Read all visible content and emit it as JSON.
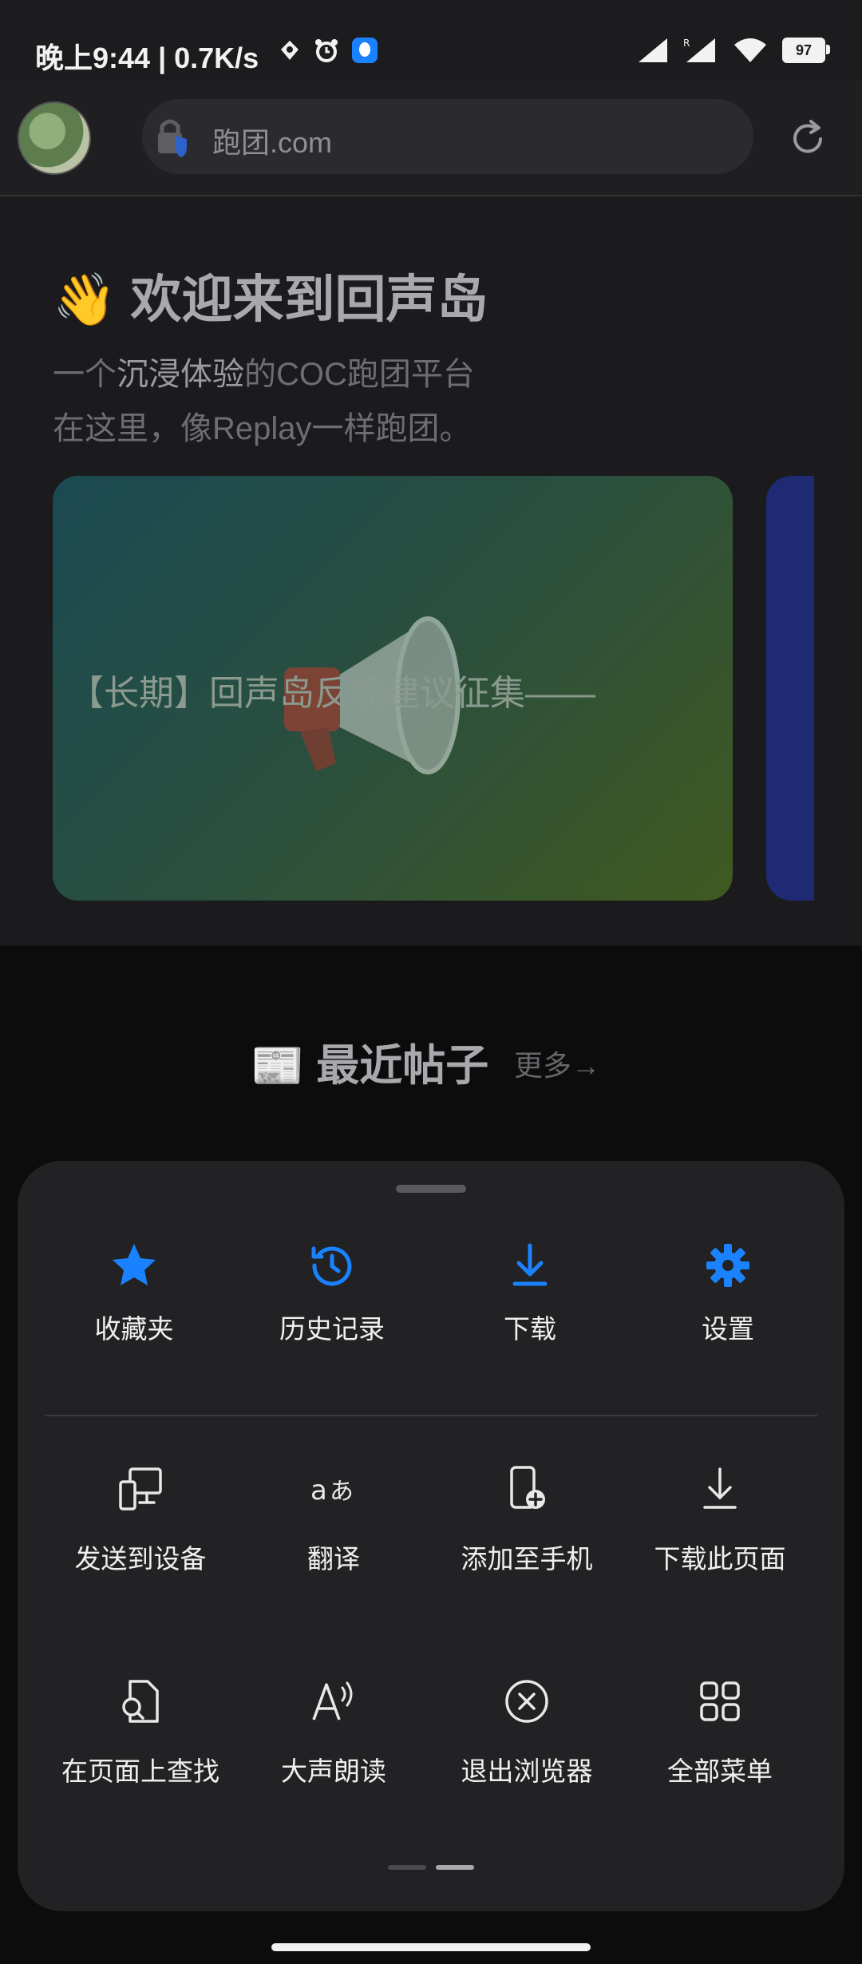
{
  "status_bar": {
    "time": "晚上9:44",
    "speed": "0.7K/s",
    "battery": "97",
    "accent": "#1a82ff"
  },
  "address_bar": {
    "url": "跑团.com"
  },
  "page": {
    "hero_emoji": "👋",
    "hero_title": "欢迎来到回声岛",
    "subtitle_prefix": "一个",
    "subtitle_highlight": "沉浸体验",
    "subtitle_suffix": "的COC跑团平台",
    "subtitle_line2": "在这里，像Replay一样跑团。",
    "banner_text": "【长期】回声岛反馈建议征集——",
    "recent_emoji": "📰",
    "recent_title": "最近帖子",
    "recent_more": "更多→"
  },
  "menu": {
    "quick_actions": [
      {
        "label": "收藏夹",
        "icon": "star-icon"
      },
      {
        "label": "历史记录",
        "icon": "history-icon"
      },
      {
        "label": "下载",
        "icon": "download-icon"
      },
      {
        "label": "设置",
        "icon": "gear-icon"
      }
    ],
    "items": [
      {
        "label": "发送到设备",
        "icon": "send-to-device-icon"
      },
      {
        "label": "翻译",
        "icon": "translate-icon"
      },
      {
        "label": "添加至手机",
        "icon": "add-to-phone-icon"
      },
      {
        "label": "下载此页面",
        "icon": "download-page-icon"
      },
      {
        "label": "在页面上查找",
        "icon": "find-in-page-icon"
      },
      {
        "label": "大声朗读",
        "icon": "read-aloud-icon"
      },
      {
        "label": "退出浏览器",
        "icon": "exit-icon"
      },
      {
        "label": "全部菜单",
        "icon": "all-menu-icon"
      }
    ]
  }
}
